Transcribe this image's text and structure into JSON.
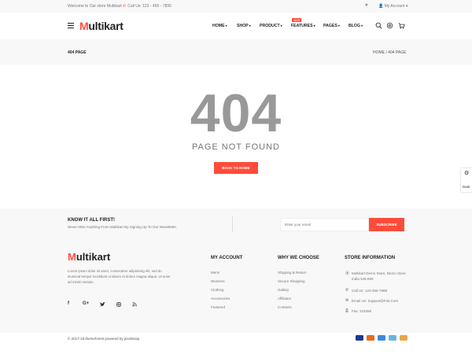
{
  "topbar": {
    "welcome": "Welcome to Our store Multikart",
    "call": "Call Us: 123 - 456 - 7890",
    "account": "My Account"
  },
  "header": {
    "logo_m": "M",
    "logo_rest": "ultikart",
    "nav": [
      {
        "label": "HOME",
        "icon": "chevron-down-icon"
      },
      {
        "label": "SHOP",
        "icon": "chevron-down-icon"
      },
      {
        "label": "PRODUCT",
        "icon": "chevron-down-icon"
      },
      {
        "label": "FEATURES",
        "icon": "chevron-down-icon"
      },
      {
        "label": "PAGES",
        "icon": "chevron-down-icon"
      },
      {
        "label": "BLOG",
        "icon": "chevron-down-icon"
      }
    ],
    "new_badge": "NEW",
    "icons": [
      "search-icon",
      "settings-icon",
      "cart-icon"
    ]
  },
  "breadcrumb": {
    "title": "404 PAGE",
    "trail": "HOME  /  404 PAGE"
  },
  "error": {
    "code": "404",
    "message": "PAGE NOT FOUND",
    "button": "BACK TO HOME"
  },
  "side_widget": {
    "label": "Dark"
  },
  "newsletter": {
    "title": "KNOW IT ALL FIRST!",
    "subtitle": "Never Miss Anything From Multikart By Signing Up To Our Newsletter.",
    "placeholder": "Enter your email",
    "button": "SUBSCRIBE"
  },
  "footer": {
    "logo_m": "M",
    "logo_rest": "ultikart",
    "about": "Lorem ipsum dolor sit amet, consectetur adipisicing elit, sed do eiusmod tempor incididunt ut labore et dolore magna aliqua. Ut enim ad minim veniam.",
    "social": [
      "f",
      "G+",
      "twitter",
      "instagram",
      "rss"
    ],
    "my_account": {
      "title": "MY ACCOUNT",
      "links": [
        "Mens",
        "Womens",
        "Clothing",
        "Accessories",
        "Featured"
      ]
    },
    "why_we_choose": {
      "title": "WHY WE CHOOSE",
      "links": [
        "Shipping & Return",
        "Secure Shopping",
        "Gallary",
        "Affiliates",
        "Contacts"
      ]
    },
    "store_info": {
      "title": "STORE INFORMATION",
      "address": "Multikart Demo Store, Demo Store India 345-659",
      "phone": "Call Us: 123-456-7898",
      "email": "Email Us: Support@Fiot.Com",
      "fax": "Fax: 123456"
    }
  },
  "bottom": {
    "copyright": "© 2017-18 themeforest powered by pixelstrap",
    "payments": [
      "visa-card-icon",
      "mastercard-icon",
      "paypal-icon",
      "amex-icon",
      "discover-icon"
    ]
  },
  "colors": {
    "accent": "#ff4c3b"
  }
}
